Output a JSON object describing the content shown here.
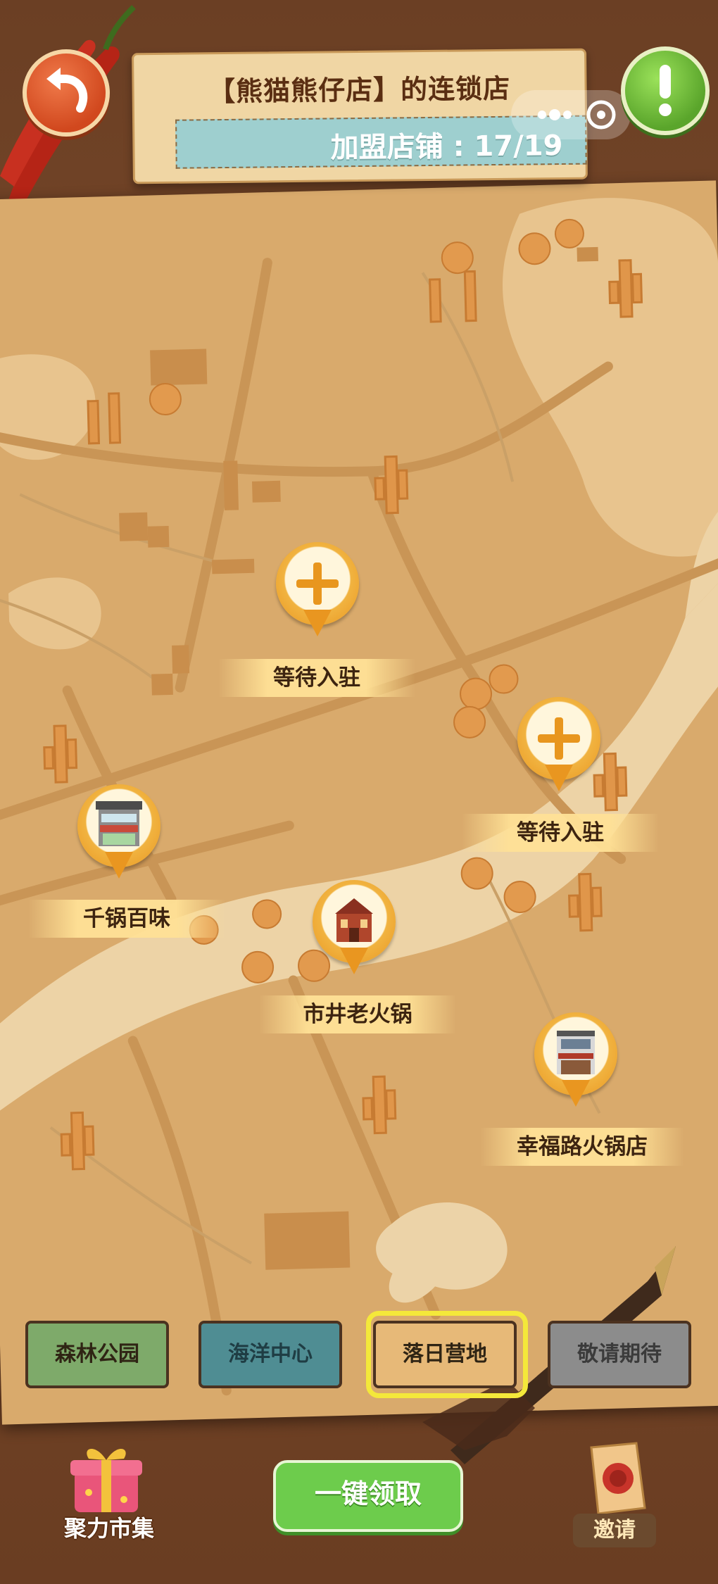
{
  "header": {
    "title": "【熊猫熊仔店】的连锁店",
    "franchise_label": "加盟店铺",
    "franchise_separator": ":",
    "franchise_count": "17/19"
  },
  "map": {
    "pins": [
      {
        "label": "等待入驻",
        "state": "empty"
      },
      {
        "label": "等待入驻",
        "state": "empty"
      },
      {
        "label": "千锅百味",
        "state": "shop"
      },
      {
        "label": "市井老火锅",
        "state": "shop"
      },
      {
        "label": "幸福路火锅店",
        "state": "shop"
      }
    ]
  },
  "tabs": [
    {
      "label": "森林公园"
    },
    {
      "label": "海洋中心"
    },
    {
      "label": "落日营地",
      "selected": true
    },
    {
      "label": "敬请期待"
    }
  ],
  "bottom": {
    "market_label": "聚力市集",
    "claim_label": "一键领取",
    "invite_label": "邀请"
  },
  "colors": {
    "map_paper": "#d9aa6c",
    "pin_orange": "#e99620",
    "selected_tab_border": "#f4e83a",
    "claim_green": "#6dcc4c",
    "back_button": "#d1481e",
    "alert_button": "#5aa52b"
  }
}
